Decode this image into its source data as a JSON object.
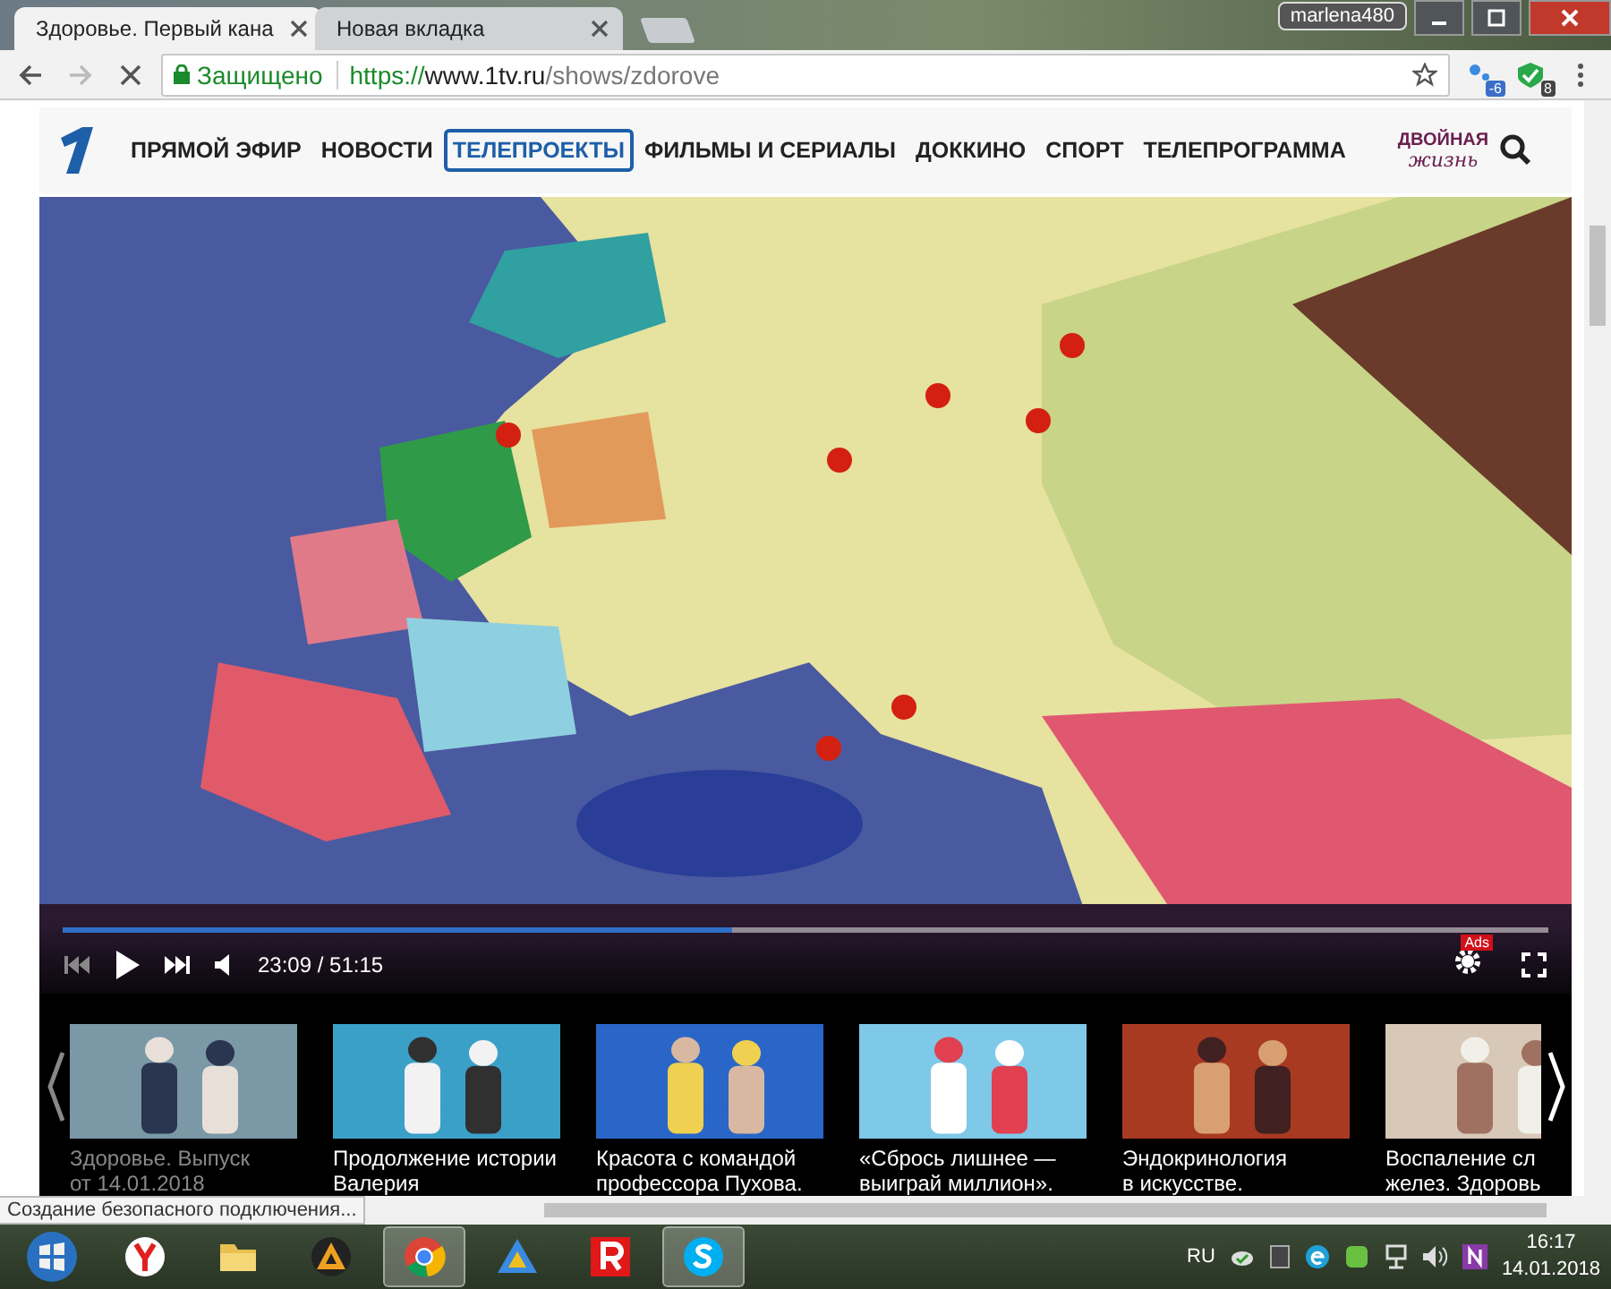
{
  "browser": {
    "tabs": [
      {
        "title": "Здоровье. Первый кана",
        "selected": true
      },
      {
        "title": "Новая вкладка",
        "selected": false
      }
    ],
    "profile": "marlena480",
    "security": "Защищено",
    "url": {
      "scheme": "https://",
      "host": "www.1tv.ru",
      "path": "/shows/zdorove"
    },
    "extensions": [
      {
        "badge": "-6"
      },
      {
        "badge": "8"
      }
    ],
    "status": "Создание безопасного подключения..."
  },
  "nav": {
    "items": [
      {
        "label": "ПРЯМОЙ ЭФИР",
        "selected": false
      },
      {
        "label": "НОВОСТИ",
        "selected": false
      },
      {
        "label": "ТЕЛЕПРОЕКТЫ",
        "selected": true
      },
      {
        "label": "ФИЛЬМЫ И СЕРИАЛЫ",
        "selected": false
      },
      {
        "label": "ДОККИНО",
        "selected": false
      },
      {
        "label": "СПОРТ",
        "selected": false
      },
      {
        "label": "ТЕЛЕПРОГРАММА",
        "selected": false
      }
    ],
    "promo": [
      "ДВОЙНАЯ",
      "жизнь"
    ]
  },
  "player": {
    "level": 0.45,
    "time": "23:09 / 51:15",
    "ads_badge": "Ads"
  },
  "carousel": [
    {
      "lines": [
        "Здоровье. Выпуск",
        "от 14.01.2018"
      ],
      "current": true
    },
    {
      "lines": [
        "Продолжение истории",
        "Валерия"
      ],
      "current": false
    },
    {
      "lines": [
        "Красота с командой",
        "профессора Пухова."
      ],
      "current": false
    },
    {
      "lines": [
        "«Сбрось лишнее —",
        "выиграй миллион»."
      ],
      "current": false
    },
    {
      "lines": [
        "Эндокринология",
        "в искусстве."
      ],
      "current": false
    },
    {
      "lines": [
        "Воспаление сл",
        "желез. Здоровь"
      ],
      "current": false
    }
  ],
  "taskbar": {
    "apps": [
      {
        "kind": "yandex",
        "active": false
      },
      {
        "kind": "folder",
        "active": false
      },
      {
        "kind": "aimp",
        "active": false
      },
      {
        "kind": "chrome",
        "active": true
      },
      {
        "kind": "triangle",
        "active": false
      },
      {
        "kind": "r",
        "active": false
      },
      {
        "kind": "skype",
        "active": true
      }
    ],
    "language": "RU",
    "time": "16:17",
    "date": "14.01.2018"
  }
}
